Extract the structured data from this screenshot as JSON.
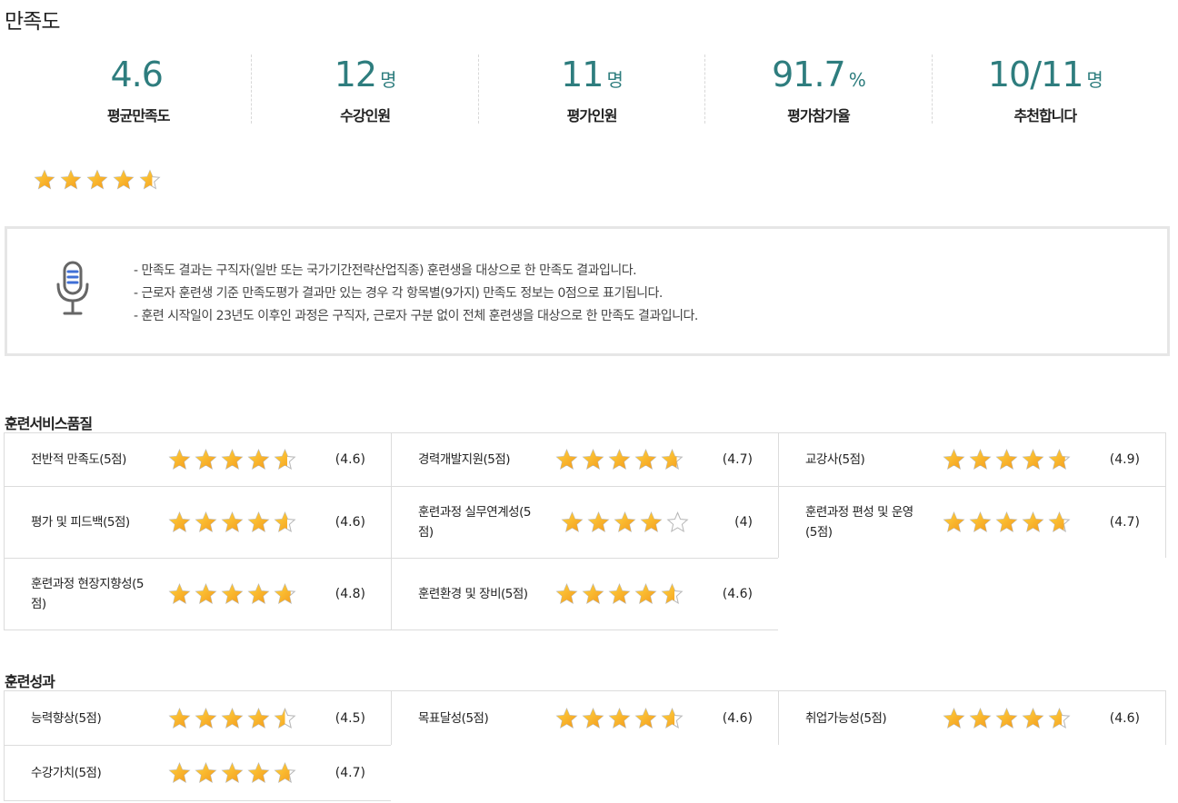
{
  "page_title": "만족도",
  "stats": [
    {
      "value": "4.6",
      "unit": "",
      "label": "평균만족도"
    },
    {
      "value": "12",
      "unit": "명",
      "label": "수강인원"
    },
    {
      "value": "11",
      "unit": "명",
      "label": "평가인원"
    },
    {
      "value": "91.7",
      "unit": "%",
      "label": "평가참가율"
    },
    {
      "value": "10/11",
      "unit": "명",
      "label": "추천합니다"
    }
  ],
  "overall_rating": 4.6,
  "notice": {
    "icon": "microphone-icon",
    "lines": [
      "-  만족도 결과는 구직자(일반 또는 국가기간전략산업직종) 훈련생을 대상으로 한 만족도 결과입니다.",
      "-  근로자 훈련생 기준 만족도평가 결과만 있는 경우 각 항목별(9가지) 만족도 정보는 0점으로 표기됩니다.",
      "-  훈련 시작일이 23년도 이후인 과정은 구직자, 근로자 구분 없이 전체 훈련생을 대상으로 한 만족도 결과입니다."
    ]
  },
  "sections": [
    {
      "title": "훈련서비스품질",
      "items": [
        {
          "name": "전반적 만족도(5점)",
          "rating": 4.6,
          "score": "(4.6)"
        },
        {
          "name": "경력개발지원(5점)",
          "rating": 4.7,
          "score": "(4.7)"
        },
        {
          "name": "교강사(5점)",
          "rating": 4.9,
          "score": "(4.9)"
        },
        {
          "name": "평가 및 피드백(5점)",
          "rating": 4.6,
          "score": "(4.6)"
        },
        {
          "name": "훈련과정 실무연계성(5점)",
          "rating": 4.0,
          "score": "(4)"
        },
        {
          "name": "훈련과정 편성 및 운영(5점)",
          "rating": 4.7,
          "score": "(4.7)"
        },
        {
          "name": "훈련과정 현장지향성(5점)",
          "rating": 4.8,
          "score": "(4.8)"
        },
        {
          "name": "훈련환경 및 장비(5점)",
          "rating": 4.6,
          "score": "(4.6)"
        }
      ]
    },
    {
      "title": "훈련성과",
      "items": [
        {
          "name": "능력향상(5점)",
          "rating": 4.5,
          "score": "(4.5)"
        },
        {
          "name": "목표달성(5점)",
          "rating": 4.6,
          "score": "(4.6)"
        },
        {
          "name": "취업가능성(5점)",
          "rating": 4.6,
          "score": "(4.6)"
        },
        {
          "name": "수강가치(5점)",
          "rating": 4.7,
          "score": "(4.7)"
        }
      ]
    }
  ],
  "colors": {
    "accent": "#2e7d7e",
    "star_light": "#ffd23f",
    "star_dark": "#f39a1c",
    "star_empty": "#ffffff",
    "star_empty_stroke": "#b8b8b8",
    "mic_blue": "#3f6fd6",
    "mic_gray": "#666666"
  }
}
